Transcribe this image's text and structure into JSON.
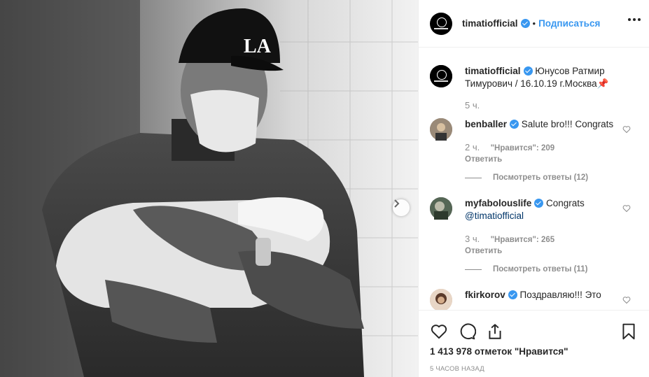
{
  "post": {
    "username": "timatiofficial",
    "follow_label": "Подписаться",
    "dot": "•",
    "caption_user": "timatiofficial",
    "caption_text": "Юнусов Ратмир Тимурович / 16.10.19 г.Москва📌",
    "caption_time": "5 ч."
  },
  "comments": [
    {
      "user": "benballer",
      "text": "Salute bro!!! Congrats",
      "time": "2 ч.",
      "likes": "\"Нравится\": 209",
      "reply": "Ответить",
      "view_replies": "Посмотреть ответы (12)"
    },
    {
      "user": "myfabolouslife",
      "text": "Congrats",
      "mention": "@timatiofficial",
      "time": "3 ч.",
      "likes": "\"Нравится\": 265",
      "reply": "Ответить",
      "view_replies": "Посмотреть ответы (11)"
    },
    {
      "user": "fkirkorov",
      "text": "Поздравляю!!! Это"
    }
  ],
  "footer": {
    "likes_total": "1 413 978 отметок \"Нравится\"",
    "posted_ago": "5 ЧАСОВ НАЗАД"
  },
  "colors": {
    "accent": "#3897f0",
    "text": "#262626",
    "muted": "#8e8e8e",
    "border": "#efefef"
  },
  "icons": [
    "verified-badge-icon",
    "more-options-icon",
    "heart-icon",
    "comment-icon",
    "share-icon",
    "bookmark-icon",
    "next-arrow-icon"
  ]
}
